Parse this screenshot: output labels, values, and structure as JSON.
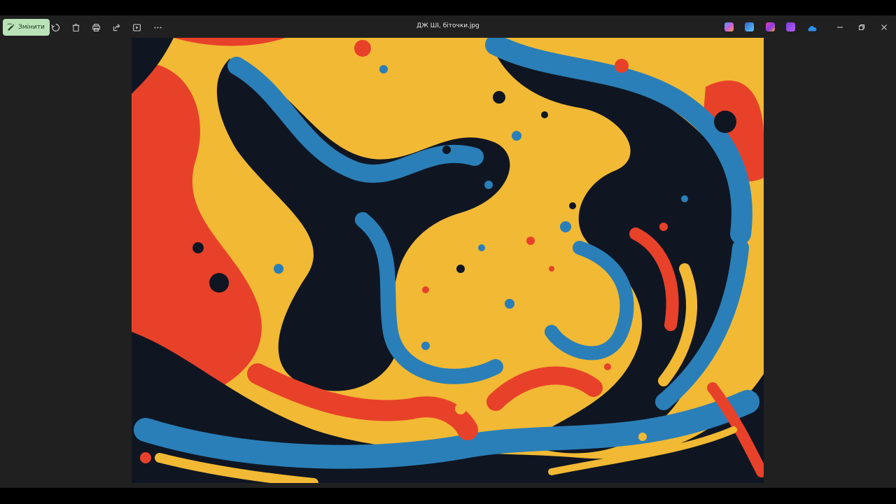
{
  "window": {
    "title": "ДЖ ШІ, біточки.jpg"
  },
  "toolbar": {
    "edit_label": "Змінити",
    "icons": [
      "edit-icon",
      "rotate-icon",
      "delete-icon",
      "print-icon",
      "share-icon",
      "slideshow-icon",
      "more-icon"
    ]
  },
  "apps": {
    "icons": [
      "copilot-icon",
      "photo-editor-icon",
      "design-icon",
      "clipchamp-icon",
      "onedrive-icon"
    ]
  },
  "window_controls": [
    "minimize-icon",
    "restore-icon",
    "close-icon"
  ],
  "colors": {
    "edit_button": "#b9e3b7",
    "background": "#202020",
    "art_yellow": "#f2b934",
    "art_blue": "#2a7fb8",
    "art_red": "#e8412a",
    "art_dark": "#0f1622"
  }
}
